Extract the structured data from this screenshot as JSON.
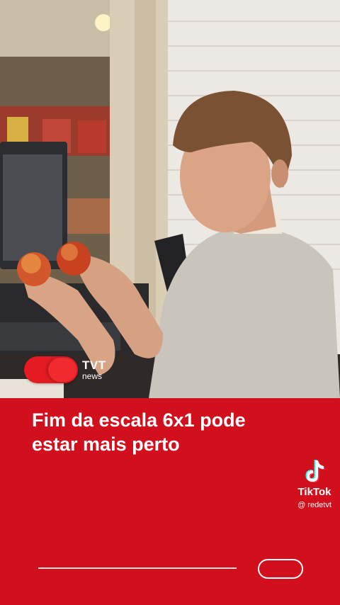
{
  "brand": {
    "name": "TVT",
    "sub": "news"
  },
  "headline": {
    "line1": "Fim da escala 6x1 pode",
    "line2": "estar mais perto"
  },
  "watermark": {
    "platform": "TikTok",
    "handle": "@ redetvt",
    "icon": "tiktok-icon"
  },
  "colors": {
    "panel": "#d2101d",
    "brand_red": "#e41b23",
    "text": "#ffffff"
  },
  "photo": {
    "icon": "store-checkout-photo"
  }
}
